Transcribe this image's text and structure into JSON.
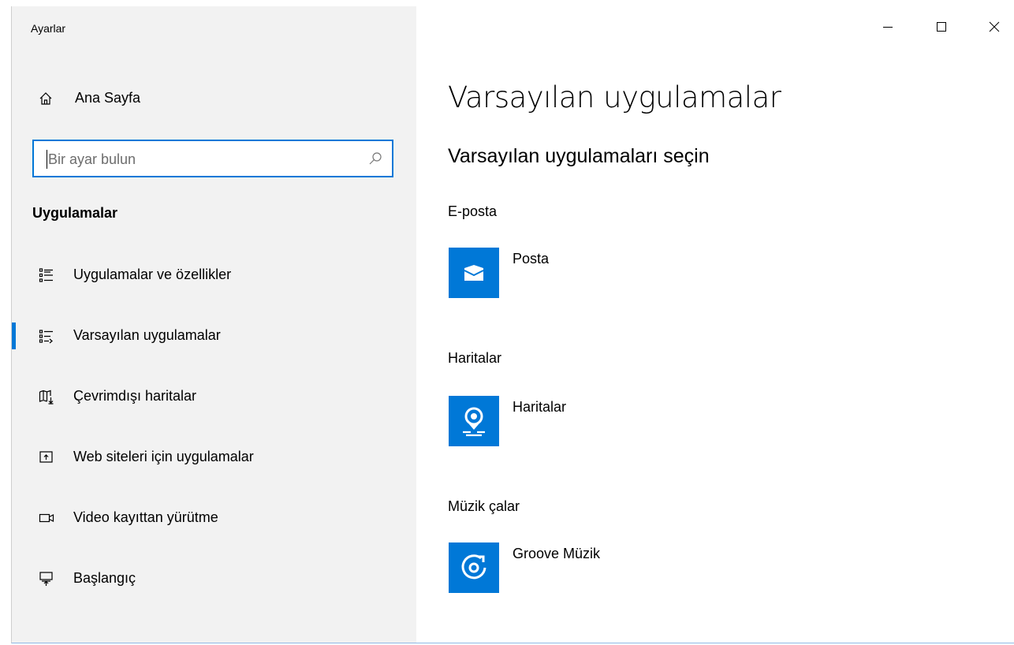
{
  "window": {
    "title": "Ayarlar"
  },
  "sidebar": {
    "home_label": "Ana Sayfa",
    "search_placeholder": "Bir ayar bulun",
    "section_title": "Uygulamalar",
    "items": [
      {
        "label": "Uygulamalar ve özellikler",
        "icon": "apps-features-icon",
        "selected": false
      },
      {
        "label": "Varsayılan uygulamalar",
        "icon": "default-apps-icon",
        "selected": true
      },
      {
        "label": "Çevrimdışı haritalar",
        "icon": "offline-maps-icon",
        "selected": false
      },
      {
        "label": "Web siteleri için uygulamalar",
        "icon": "apps-for-websites-icon",
        "selected": false
      },
      {
        "label": "Video kayıttan yürütme",
        "icon": "video-playback-icon",
        "selected": false
      },
      {
        "label": "Başlangıç",
        "icon": "startup-icon",
        "selected": false
      }
    ]
  },
  "main": {
    "title": "Varsayılan uygulamalar",
    "subtitle": "Varsayılan uygulamaları seçin",
    "categories": [
      {
        "label": "E-posta",
        "app": "Posta",
        "icon": "mail-icon"
      },
      {
        "label": "Haritalar",
        "app": "Haritalar",
        "icon": "maps-icon"
      },
      {
        "label": "Müzik çalar",
        "app": "Groove Müzik",
        "icon": "groove-music-icon"
      }
    ]
  },
  "colors": {
    "accent": "#0078d7",
    "sidebar_bg": "#f2f2f2"
  }
}
